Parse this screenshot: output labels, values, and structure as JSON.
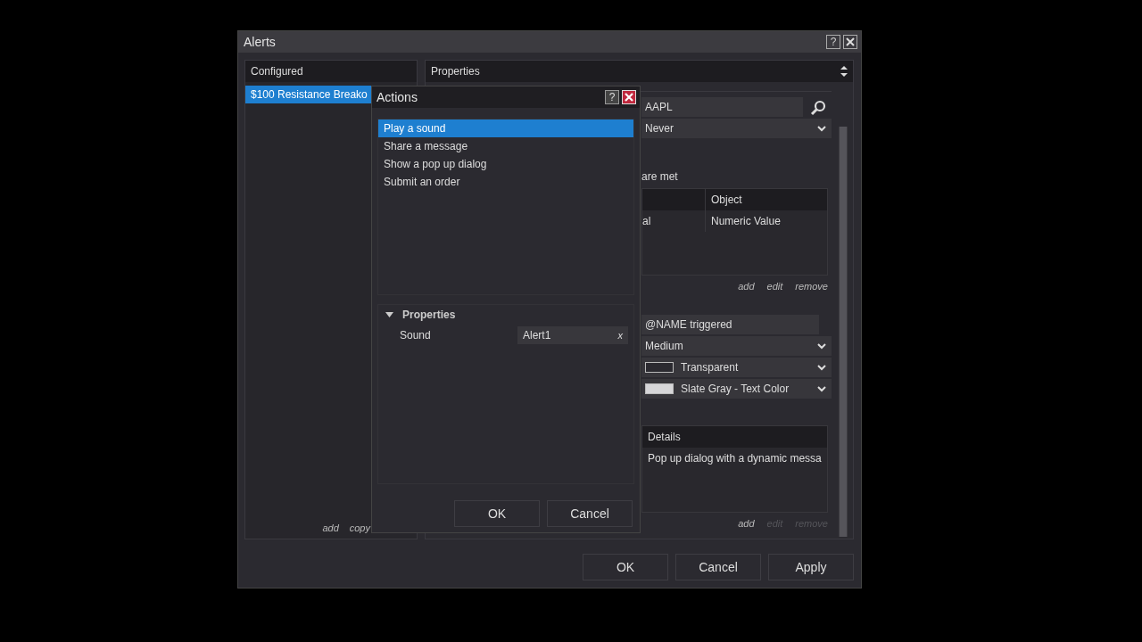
{
  "alerts_window": {
    "title": "Alerts",
    "configured": {
      "header": "Configured",
      "items": [
        {
          "label": "$100 Resistance Breako",
          "selected": true
        }
      ],
      "links": [
        "add",
        "copy"
      ]
    },
    "properties": {
      "header": "Properties",
      "instrument": "AAPL",
      "rearm": "Never",
      "conditions_text": "are met",
      "conditions_table": {
        "columns": [
          "",
          "Object"
        ],
        "rows": [
          [
            "al",
            "Numeric Value"
          ]
        ]
      },
      "condition_links": [
        {
          "label": "add",
          "disabled": false
        },
        {
          "label": "edit",
          "disabled": false
        },
        {
          "label": "remove",
          "disabled": false
        }
      ],
      "message": "@NAME triggered",
      "priority": "Medium",
      "background": {
        "label": "Transparent",
        "color": "#2b2a30"
      },
      "foreground": {
        "label": "Slate Gray - Text Color",
        "color": "#d6d6d8"
      },
      "actions_table": {
        "columns": [
          "Details"
        ],
        "rows": [
          [
            "Pop up dialog with a dynamic messa"
          ]
        ]
      },
      "action_links": [
        {
          "label": "add",
          "disabled": false
        },
        {
          "label": "edit",
          "disabled": true
        },
        {
          "label": "remove",
          "disabled": true
        }
      ]
    },
    "buttons": [
      "OK",
      "Cancel",
      "Apply"
    ]
  },
  "actions_dialog": {
    "title": "Actions",
    "help": "?",
    "actions": [
      {
        "label": "Play a sound",
        "selected": true
      },
      {
        "label": "Share a message",
        "selected": false
      },
      {
        "label": "Show a pop up dialog",
        "selected": false
      },
      {
        "label": "Submit an order",
        "selected": false
      }
    ],
    "properties": {
      "header": "Properties",
      "expanded": true,
      "rows": [
        {
          "name": "Sound",
          "value": "Alert1",
          "clear": "x"
        }
      ]
    },
    "buttons": [
      "OK",
      "Cancel"
    ]
  }
}
